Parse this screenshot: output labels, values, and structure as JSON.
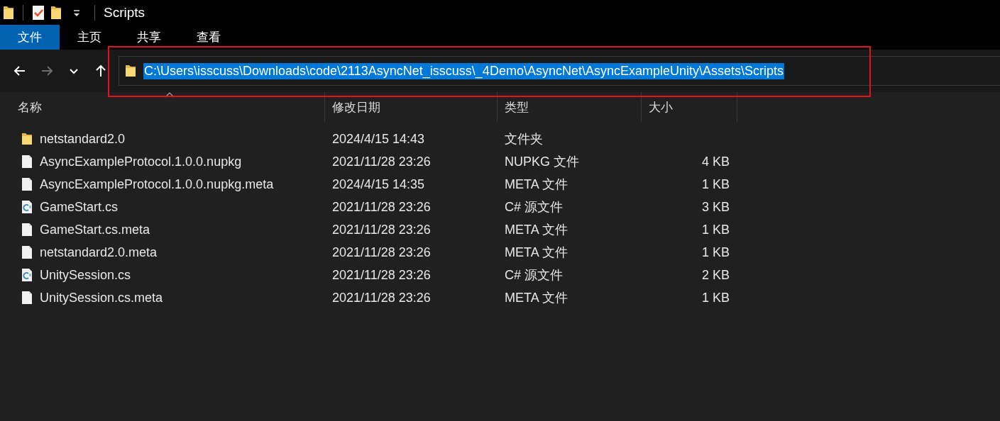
{
  "window": {
    "title": "Scripts"
  },
  "ribbon_tabs": [
    {
      "label": "文件",
      "selected": true
    },
    {
      "label": "主页",
      "selected": false
    },
    {
      "label": "共享",
      "selected": false
    },
    {
      "label": "查看",
      "selected": false
    }
  ],
  "nav_buttons": [
    {
      "kind": "back",
      "disabled": false
    },
    {
      "kind": "forward",
      "disabled": true
    },
    {
      "kind": "recent",
      "disabled": false
    },
    {
      "kind": "up",
      "disabled": false
    }
  ],
  "address": {
    "path": "C:\\Users\\isscuss\\Downloads\\code\\2113AsyncNet_isscuss\\_4Demo\\AsyncNet\\AsyncExampleUnity\\Assets\\Scripts",
    "selected": true
  },
  "table": {
    "columns": [
      "名称",
      "修改日期",
      "类型",
      "大小"
    ],
    "rows": [
      {
        "kind": "folder",
        "name": "netstandard2.0",
        "modified": "2024/4/15 14:43",
        "type": "文件夹"
      },
      {
        "kind": "file",
        "name": "AsyncExampleProtocol.1.0.0.nupkg",
        "modified": "2021/11/28 23:26",
        "type": "NUPKG 文件",
        "size": "4 KB"
      },
      {
        "kind": "file",
        "name": "AsyncExampleProtocol.1.0.0.nupkg.meta",
        "modified": "2024/4/15 14:35",
        "type": "META 文件",
        "size": "1 KB"
      },
      {
        "kind": "csharp",
        "name": "GameStart.cs",
        "modified": "2021/11/28 23:26",
        "type": "C# 源文件",
        "size": "3 KB"
      },
      {
        "kind": "file",
        "name": "GameStart.cs.meta",
        "modified": "2021/11/28 23:26",
        "type": "META 文件",
        "size": "1 KB"
      },
      {
        "kind": "file",
        "name": "netstandard2.0.meta",
        "modified": "2021/11/28 23:26",
        "type": "META 文件",
        "size": "1 KB"
      },
      {
        "kind": "csharp",
        "name": "UnitySession.cs",
        "modified": "2021/11/28 23:26",
        "type": "C# 源文件",
        "size": "2 KB"
      },
      {
        "kind": "file",
        "name": "UnitySession.cs.meta",
        "modified": "2021/11/28 23:26",
        "type": "META 文件",
        "size": "1 KB"
      }
    ]
  }
}
